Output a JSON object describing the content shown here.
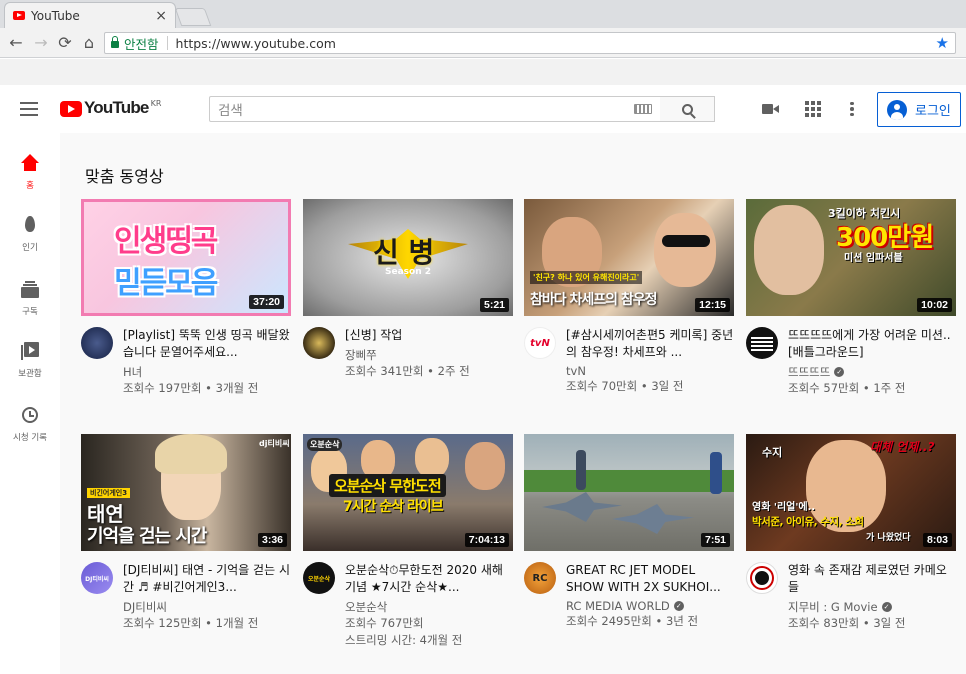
{
  "browser": {
    "tab_title": "YouTube",
    "tab_close": "×",
    "secure_label": "안전함",
    "url": "https://www.youtube.com",
    "back": "←",
    "forward": "→",
    "reload": "⟳",
    "home": "⌂",
    "star": "★"
  },
  "header": {
    "logo_word": "YouTube",
    "logo_region": "KR",
    "search_placeholder": "검색",
    "login_label": "로그인"
  },
  "sidebar": {
    "items": [
      {
        "label": "홈",
        "icon": "home-icon"
      },
      {
        "label": "인기",
        "icon": "fire-icon"
      },
      {
        "label": "구독",
        "icon": "subscriptions-icon"
      },
      {
        "label": "보관함",
        "icon": "library-icon"
      },
      {
        "label": "시청 기록",
        "icon": "history-icon"
      }
    ]
  },
  "main": {
    "section_title": "맞춤 동영상",
    "videos": [
      {
        "title": "[Playlist] 뚝뚝 인생 띵곡 배달왔습니다 문열어주세요...",
        "channel": "H녀",
        "verified": false,
        "views": "조회수 197만회",
        "age": "3개월 전",
        "duration": "37:20",
        "thumb_text": [
          "인생띵곡",
          "믿듣모음"
        ]
      },
      {
        "title": "[신병] 작업",
        "channel": "장삐쭈",
        "verified": false,
        "views": "조회수 341만회",
        "age": "2주 전",
        "duration": "5:21",
        "thumb_text": [
          "신 병",
          "Season 2"
        ]
      },
      {
        "title": "[#삼시세끼어촌편5 케미록] 중년의 참우정! 차세프와 ...",
        "channel": "tvN",
        "verified": false,
        "views": "조회수 70만회",
        "age": "3일 전",
        "duration": "12:15",
        "thumb_text": [
          "참바다 차세프의 참우정",
          "'친구? 하나 있어 유해진이라고'"
        ],
        "channel_logo": "tvN"
      },
      {
        "title": "뜨뜨뜨뜨에게 가장 어려운 미션.. [배틀그라운드]",
        "channel": "뜨뜨뜨뜨",
        "verified": true,
        "views": "조회수 57만회",
        "age": "1주 전",
        "duration": "10:02",
        "thumb_text": [
          "3킬이하 치킨시",
          "300만원",
          "미션 임파서블"
        ]
      },
      {
        "title": "[DJ티비씨] 태연 - 기억을 걷는 시간 ♬ #비긴어게인3...",
        "channel": "DJ티비씨",
        "verified": false,
        "views": "조회수 125만회",
        "age": "1개월 전",
        "duration": "3:36",
        "thumb_text": [
          "태연",
          "기억을 걷는 시간",
          "비긴어게인3",
          "dj티비씨"
        ],
        "channel_logo": "DJ티비씨"
      },
      {
        "title": "오분순삭⏱무한도전 2020 새해 기념 ★7시간 순삭★...",
        "channel": "오분순삭",
        "verified": false,
        "views": "조회수 767만회",
        "age": "스트리밍 시간: 4개월 전",
        "duration": "7:04:13",
        "thumb_text": [
          "오분순삭",
          "오분순삭 무한도전",
          "7시간 순삭 라이브"
        ],
        "channel_logo": "오분순삭"
      },
      {
        "title": "GREAT RC JET MODEL SHOW WITH 2X SUKHOI...",
        "channel": "RC MEDIA WORLD",
        "verified": true,
        "views": "조회수 2495만회",
        "age": "3년 전",
        "duration": "7:51",
        "channel_logo": "RC"
      },
      {
        "title": "영화 속 존재감 제로였던 카메오들",
        "channel": "지무비 : G Movie",
        "verified": true,
        "views": "조회수 83만회",
        "age": "3일 전",
        "duration": "8:03",
        "thumb_text": [
          "수지",
          "대체 언제..?",
          "영화 '리얼'에..",
          "박서준, 아이유, 수지, 소희",
          "가 나왔었다"
        ]
      }
    ]
  },
  "colors": {
    "brand_red": "#ff0000",
    "link_blue": "#065fd4",
    "secure_green": "#0b8043"
  }
}
